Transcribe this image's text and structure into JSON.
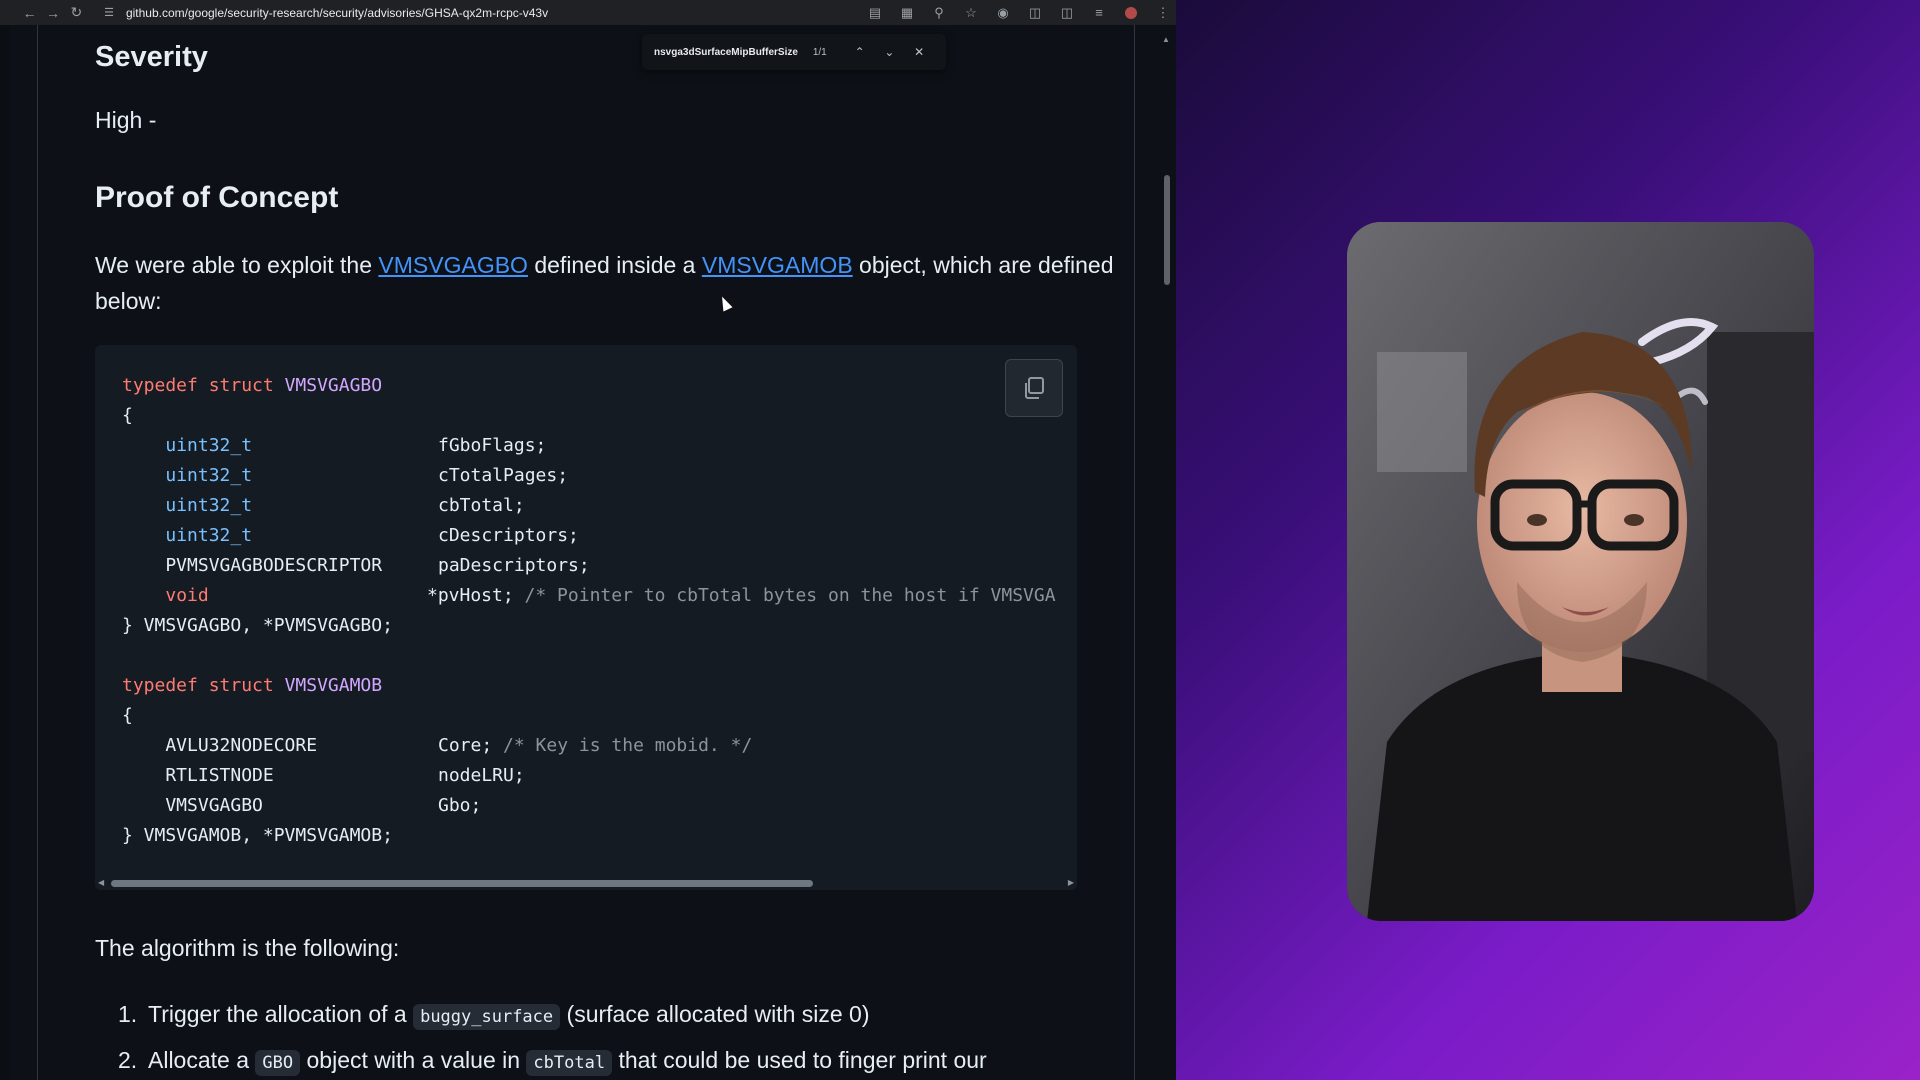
{
  "browser": {
    "url": "github.com/google/security-research/security/advisories/GHSA-qx2m-rcpc-v43v",
    "find": {
      "query": "nsvga3dSurfaceMipBufferSize",
      "count": "1/1"
    }
  },
  "article": {
    "severity_heading": "Severity",
    "severity_value": "High -",
    "poc_heading": "Proof of Concept",
    "poc_intro": {
      "text1": "We were able to exploit the ",
      "link1": "VMSVGAGBO",
      "text2": " defined inside a ",
      "link2": "VMSVGAMOB",
      "text3": " object, which are defined below:"
    },
    "code_lines": [
      {
        "parts": [
          {
            "t": "typedef",
            "c": "kw"
          },
          {
            "t": " "
          },
          {
            "t": "struct",
            "c": "kw"
          },
          {
            "t": " "
          },
          {
            "t": "VMSVGAGBO",
            "c": "ty"
          }
        ],
        "col2": ""
      },
      {
        "parts": [
          {
            "t": "{"
          }
        ],
        "col2": ""
      },
      {
        "parts": [
          {
            "t": "    "
          },
          {
            "t": "uint32_t",
            "c": "bt"
          }
        ],
        "col2": "fGboFlags;"
      },
      {
        "parts": [
          {
            "t": "    "
          },
          {
            "t": "uint32_t",
            "c": "bt"
          }
        ],
        "col2": "cTotalPages;"
      },
      {
        "parts": [
          {
            "t": "    "
          },
          {
            "t": "uint32_t",
            "c": "bt"
          }
        ],
        "col2": "cbTotal;"
      },
      {
        "parts": [
          {
            "t": "    "
          },
          {
            "t": "uint32_t",
            "c": "bt"
          }
        ],
        "col2": "cDescriptors;"
      },
      {
        "parts": [
          {
            "t": "    PVMSVGAGBODESCRIPTOR"
          }
        ],
        "col2": "paDescriptors;"
      },
      {
        "parts": [
          {
            "t": "    "
          },
          {
            "t": "void",
            "c": "kw"
          }
        ],
        "col2": "*pvHost; ",
        "comment": "/* Pointer to cbTotal bytes on the host if VMSVGA"
      },
      {
        "parts": [
          {
            "t": "} VMSVGAGBO, *PVMSVGAGBO;"
          }
        ],
        "col2": ""
      },
      {
        "parts": [
          {
            "t": ""
          }
        ],
        "col2": ""
      },
      {
        "parts": [
          {
            "t": "typedef",
            "c": "kw"
          },
          {
            "t": " "
          },
          {
            "t": "struct",
            "c": "kw"
          },
          {
            "t": " "
          },
          {
            "t": "VMSVGAMOB",
            "c": "ty"
          }
        ],
        "col2": ""
      },
      {
        "parts": [
          {
            "t": "{"
          }
        ],
        "col2": ""
      },
      {
        "parts": [
          {
            "t": "    AVLU32NODECORE"
          }
        ],
        "col2": "Core; ",
        "comment": "/* Key is the mobid. */"
      },
      {
        "parts": [
          {
            "t": "    RTLISTNODE"
          }
        ],
        "col2": "nodeLRU;"
      },
      {
        "parts": [
          {
            "t": "    VMSVGAGBO"
          }
        ],
        "col2": "Gbo;"
      },
      {
        "parts": [
          {
            "t": "} VMSVGAMOB, *PVMSVGAMOB;"
          }
        ],
        "col2": ""
      }
    ],
    "algo_title": "The algorithm is the following:",
    "steps": [
      {
        "num": "1.",
        "pre": "Trigger the allocation of a ",
        "code": "buggy_surface",
        "post": " (surface allocated with size 0)"
      },
      {
        "num": "2.",
        "pre": "Allocate a ",
        "code": "GBO",
        "mid": " object with a value in ",
        "code2": "cbTotal",
        "post": " that could be used to finger print our"
      }
    ]
  },
  "icons": [
    "back-icon",
    "forward-icon",
    "reload-icon",
    "site-settings-icon",
    "cast-icon",
    "reader-icon",
    "zoom-icon",
    "bookmark-star-icon",
    "extension-icon",
    "puzzle-icon",
    "sidebar-icon",
    "tab-search-icon",
    "profile-avatar",
    "more-menu-icon",
    "copy-icon"
  ],
  "colors": {
    "page_bg": "#0d1117",
    "link": "#4493f8",
    "keyword": "#ff7b72",
    "type": "#d2a8ff",
    "builtin": "#79c0ff",
    "comment": "#8b949e",
    "backdrop_start": "#1a0b3a",
    "backdrop_end": "#9a22c8"
  }
}
